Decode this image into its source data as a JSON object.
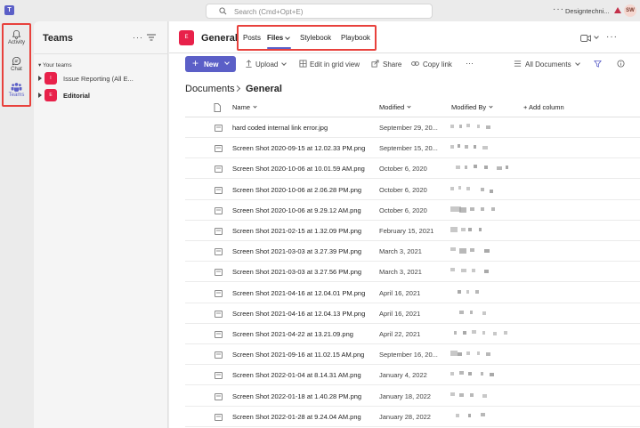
{
  "app": {
    "logo_letter": "T"
  },
  "search": {
    "placeholder": "Search (Cmd+Opt+E)"
  },
  "topbar": {
    "org_name": "Designtechni...",
    "avatar_initials": "SW",
    "more": "···"
  },
  "rail": {
    "items": [
      {
        "label": "Activity",
        "icon": "bell-icon"
      },
      {
        "label": "Chat",
        "icon": "chat-icon"
      },
      {
        "label": "Teams",
        "icon": "teams-icon"
      }
    ]
  },
  "teams_pane": {
    "title": "Teams",
    "more": "···",
    "section_label": "Your teams",
    "teams": [
      {
        "name": "Issue Reporting (All E...",
        "avatar": "I",
        "bold": false
      },
      {
        "name": "Editorial",
        "avatar": "E",
        "bold": true
      }
    ]
  },
  "channel": {
    "avatar": "E",
    "name": "General",
    "tabs": [
      {
        "label": "Posts"
      },
      {
        "label": "Files"
      },
      {
        "label": "Stylebook"
      },
      {
        "label": "Playbook"
      }
    ],
    "more": "···"
  },
  "toolbar": {
    "new_label": "New",
    "upload_label": "Upload",
    "grid_label": "Edit in grid view",
    "share_label": "Share",
    "copy_link_label": "Copy link",
    "more": "···",
    "view_label": "All Documents"
  },
  "breadcrumb": {
    "root": "Documents",
    "current": "General"
  },
  "table": {
    "columns": {
      "name": "Name",
      "modified": "Modified",
      "modified_by": "Modified By",
      "add": "+ Add column"
    },
    "rows": [
      {
        "name": "hard coded internal link error.jpg",
        "modified": "September 29, 20..."
      },
      {
        "name": "Screen Shot 2020-09-15 at 12.02.33 PM.png",
        "modified": "September 15, 20..."
      },
      {
        "name": "Screen Shot 2020-10-06 at 10.01.59 AM.png",
        "modified": "October 6, 2020"
      },
      {
        "name": "Screen Shot 2020-10-06 at 2.06.28 PM.png",
        "modified": "October 6, 2020"
      },
      {
        "name": "Screen Shot 2020-10-06 at 9.29.12 AM.png",
        "modified": "October 6, 2020"
      },
      {
        "name": "Screen Shot 2021-02-15 at 1.32.09 PM.png",
        "modified": "February 15, 2021"
      },
      {
        "name": "Screen Shot 2021-03-03 at 3.27.39 PM.png",
        "modified": "March 3, 2021"
      },
      {
        "name": "Screen Shot 2021-03-03 at 3.27.56 PM.png",
        "modified": "March 3, 2021"
      },
      {
        "name": "Screen Shot 2021-04-16 at 12.04.01 PM.png",
        "modified": "April 16, 2021"
      },
      {
        "name": "Screen Shot 2021-04-16 at 12.04.13 PM.png",
        "modified": "April 16, 2021"
      },
      {
        "name": "Screen Shot 2021-04-22 at 13.21.09.png",
        "modified": "April 22, 2021"
      },
      {
        "name": "Screen Shot 2021-09-16 at 11.02.15 AM.png",
        "modified": "September 16, 20..."
      },
      {
        "name": "Screen Shot 2022-01-04 at 8.14.31 AM.png",
        "modified": "January 4, 2022"
      },
      {
        "name": "Screen Shot 2022-01-18 at 1.40.28 PM.png",
        "modified": "January 18, 2022"
      },
      {
        "name": "Screen Shot 2022-01-28 at 9.24.04 AM.png",
        "modified": "January 28, 2022"
      }
    ]
  },
  "colors": {
    "accent": "#5b5fc7",
    "highlight": "#e8413c",
    "team_avatar": "#e8214a"
  }
}
